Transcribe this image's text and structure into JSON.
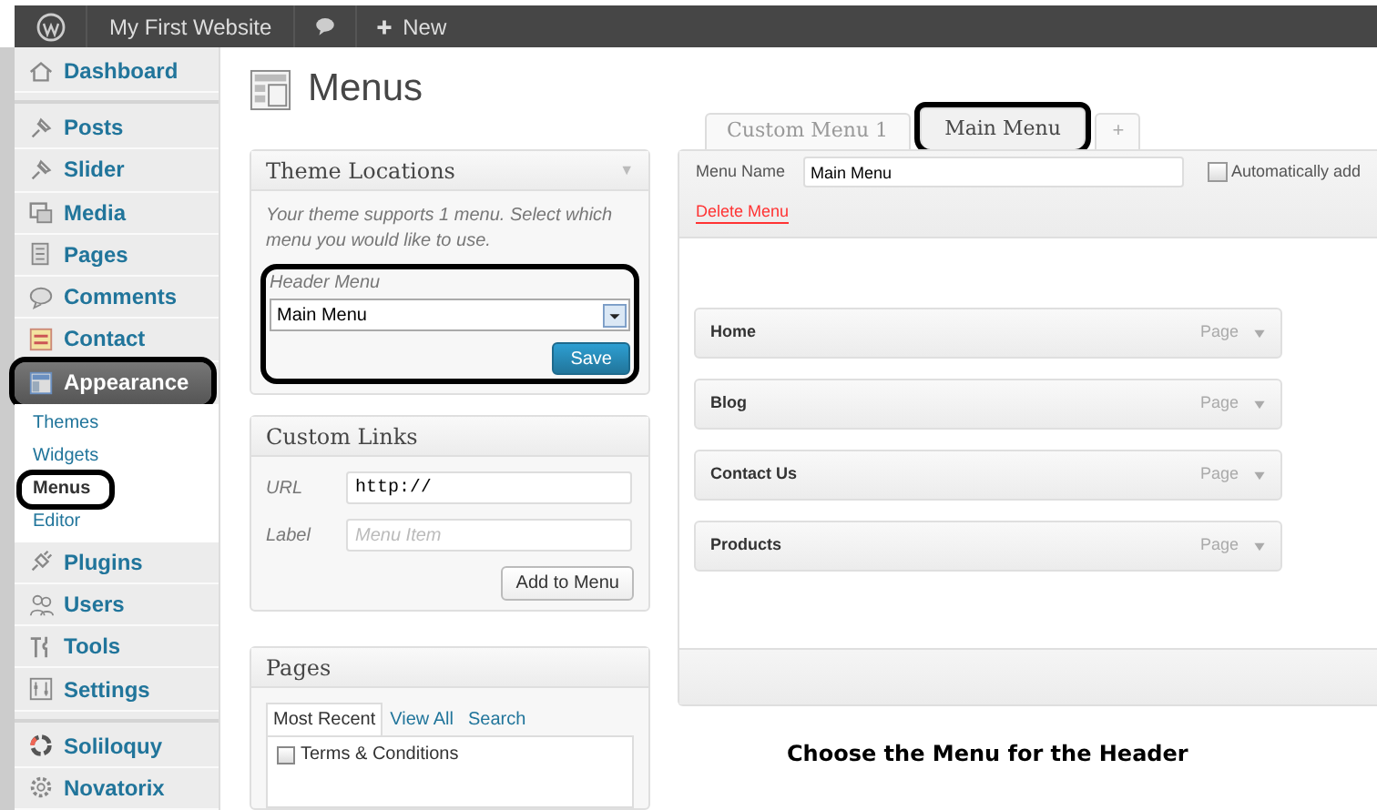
{
  "admin_bar": {
    "site_name": "My First Website",
    "new_label": "New"
  },
  "sidebar": {
    "groups": [
      [
        {
          "label": "Dashboard",
          "selected": false,
          "highlighted": false
        }
      ],
      [
        {
          "label": "Posts",
          "selected": false,
          "highlighted": false
        },
        {
          "label": "Slider",
          "selected": false,
          "highlighted": false
        },
        {
          "label": "Media",
          "selected": false,
          "highlighted": false
        },
        {
          "label": "Pages",
          "selected": false,
          "highlighted": false
        },
        {
          "label": "Comments",
          "selected": false,
          "highlighted": false
        },
        {
          "label": "Contact",
          "selected": false,
          "highlighted": false
        },
        {
          "label": "Appearance",
          "selected": true,
          "highlighted": true,
          "children": [
            {
              "label": "Themes",
              "selected": false,
              "highlighted": false
            },
            {
              "label": "Widgets",
              "selected": false,
              "highlighted": false
            },
            {
              "label": "Menus",
              "selected": true,
              "highlighted": true
            },
            {
              "label": "Editor",
              "selected": false,
              "highlighted": false
            }
          ]
        },
        {
          "label": "Plugins",
          "selected": false,
          "highlighted": false
        },
        {
          "label": "Users",
          "selected": false,
          "highlighted": false
        },
        {
          "label": "Tools",
          "selected": false,
          "highlighted": false
        },
        {
          "label": "Settings",
          "selected": false,
          "highlighted": false
        }
      ],
      [
        {
          "label": "Soliloquy",
          "selected": false,
          "highlighted": false
        },
        {
          "label": "Novatorix",
          "selected": false,
          "highlighted": false
        }
      ]
    ]
  },
  "page_title": "Menus",
  "theme_locations": {
    "title": "Theme Locations",
    "description": "Your theme supports 1 menu. Select which menu you would like to use.",
    "location_label": "Header Menu",
    "location_value": "Main Menu",
    "highlighted": true,
    "collapse_glyph": "▼",
    "save": "Save"
  },
  "custom_links": {
    "title": "Custom Links",
    "url_label": "URL",
    "url_value": "http://",
    "label_label": "Label",
    "label_placeholder": "Menu Item",
    "button": "Add to Menu"
  },
  "pages": {
    "title": "Pages",
    "tabs": [
      {
        "label": "Most Recent",
        "selected": true
      },
      {
        "label": "View All",
        "selected": false
      },
      {
        "label": "Search",
        "selected": false
      }
    ],
    "items": [
      {
        "label": "Terms & Conditions",
        "checked": false
      }
    ]
  },
  "menu_tabs": [
    {
      "label": "Custom Menu 1",
      "selected": false,
      "highlighted": false
    },
    {
      "label": "Main Menu",
      "selected": true,
      "highlighted": true
    }
  ],
  "add_tab": "+",
  "menu_editor": {
    "name_label": "Menu Name",
    "name_value": "Main Menu",
    "auto_add_label": "Automatically add",
    "auto_add_checked": false,
    "delete": "Delete Menu",
    "items": [
      {
        "title": "Home",
        "type": "Page"
      },
      {
        "title": "Blog",
        "type": "Page"
      },
      {
        "title": "Contact Us",
        "type": "Page"
      },
      {
        "title": "Products",
        "type": "Page"
      }
    ]
  },
  "caption": "Choose the Menu for the Header"
}
